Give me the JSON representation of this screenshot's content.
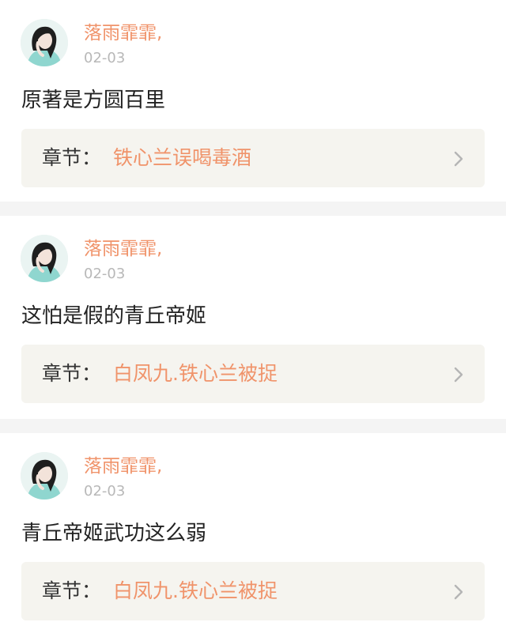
{
  "comments": [
    {
      "username": "落雨霏霏,",
      "date": "02-03",
      "text": "原著是方圆百里",
      "chapter_prefix": "章节：",
      "chapter_title": "铁心兰误喝毒酒",
      "avatar_icon": "user-avatar"
    },
    {
      "username": "落雨霏霏,",
      "date": "02-03",
      "text": "这怕是假的青丘帝姬",
      "chapter_prefix": "章节：",
      "chapter_title": "白凤九.铁心兰被捉",
      "avatar_icon": "user-avatar"
    },
    {
      "username": "落雨霏霏,",
      "date": "02-03",
      "text": "青丘帝姬武功这么弱",
      "chapter_prefix": "章节：",
      "chapter_title": "白凤九.铁心兰被捉",
      "avatar_icon": "user-avatar"
    }
  ],
  "colors": {
    "accent": "#f0936a",
    "date": "#b8b8b8",
    "chapter_bg": "#f5f4ef",
    "separator": "#f4f4f4"
  },
  "icons": {
    "chevron": "chevron-right-icon"
  }
}
